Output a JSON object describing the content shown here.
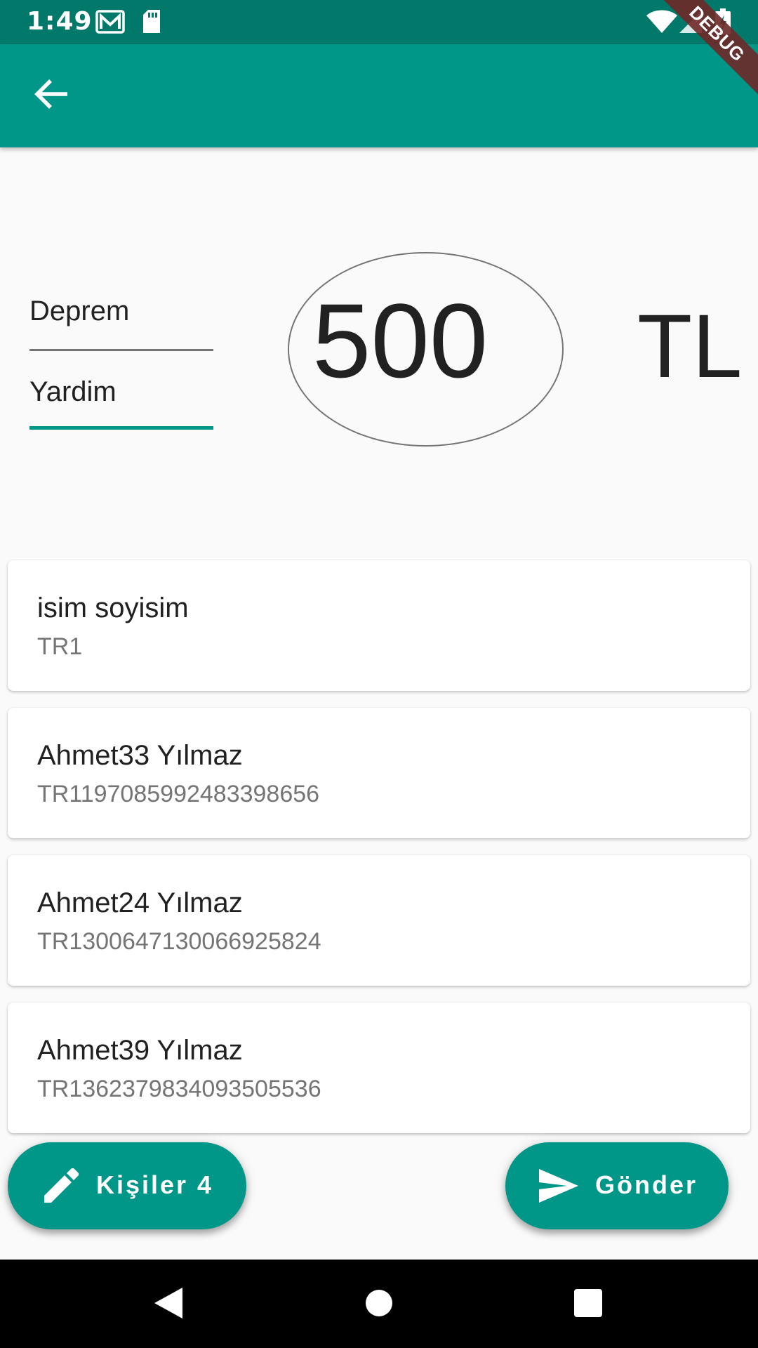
{
  "status_bar": {
    "time": "1:49",
    "icons": [
      "gmail-icon",
      "sd-card-icon",
      "wifi-icon",
      "signal-icon",
      "battery-charging-icon"
    ]
  },
  "debug_banner": "DEBUG",
  "app_bar": {
    "back_icon": "arrow-back-icon"
  },
  "form": {
    "field1": "Deprem",
    "field2": "Yardim",
    "amount": "500",
    "currency": "TL"
  },
  "recipients": [
    {
      "name": "isim soyisim",
      "iban": "TR1"
    },
    {
      "name": "Ahmet33 Yılmaz",
      "iban": "TR1197085992483398656"
    },
    {
      "name": "Ahmet24 Yılmaz",
      "iban": "TR1300647130066925824"
    },
    {
      "name": "Ahmet39 Yılmaz",
      "iban": "TR1362379834093505536"
    }
  ],
  "fabs": {
    "contacts_label": "Kişiler 4",
    "contacts_icon": "pencil-icon",
    "send_label": "Gönder",
    "send_icon": "send-icon"
  },
  "nav_bar": {
    "buttons": [
      "back-triangle-icon",
      "home-circle-icon",
      "recents-square-icon"
    ]
  },
  "colors": {
    "primary": "#009688",
    "primary_dark": "#00796b",
    "accent_underline": "#009688"
  }
}
